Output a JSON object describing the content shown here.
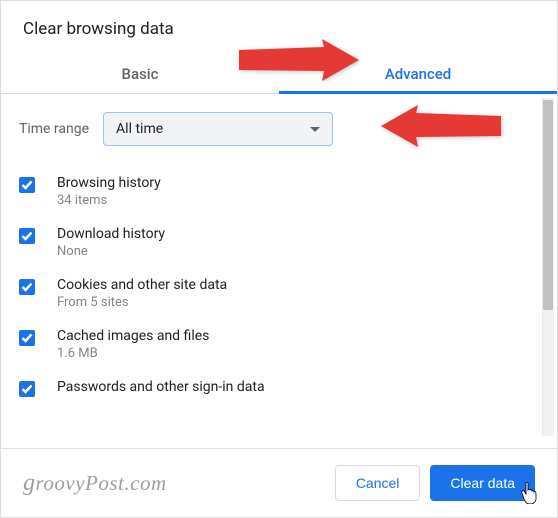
{
  "title": "Clear browsing data",
  "tabs": {
    "basic": "Basic",
    "advanced": "Advanced"
  },
  "time": {
    "label": "Time range",
    "value": "All time"
  },
  "options": [
    {
      "label": "Browsing history",
      "sub": "34 items"
    },
    {
      "label": "Download history",
      "sub": "None"
    },
    {
      "label": "Cookies and other site data",
      "sub": "From 5 sites"
    },
    {
      "label": "Cached images and files",
      "sub": "1.6 MB"
    },
    {
      "label": "Passwords and other sign-in data",
      "sub": ""
    }
  ],
  "footer": {
    "cancel": "Cancel",
    "clear": "Clear data",
    "watermark": "groovyPost.com"
  }
}
